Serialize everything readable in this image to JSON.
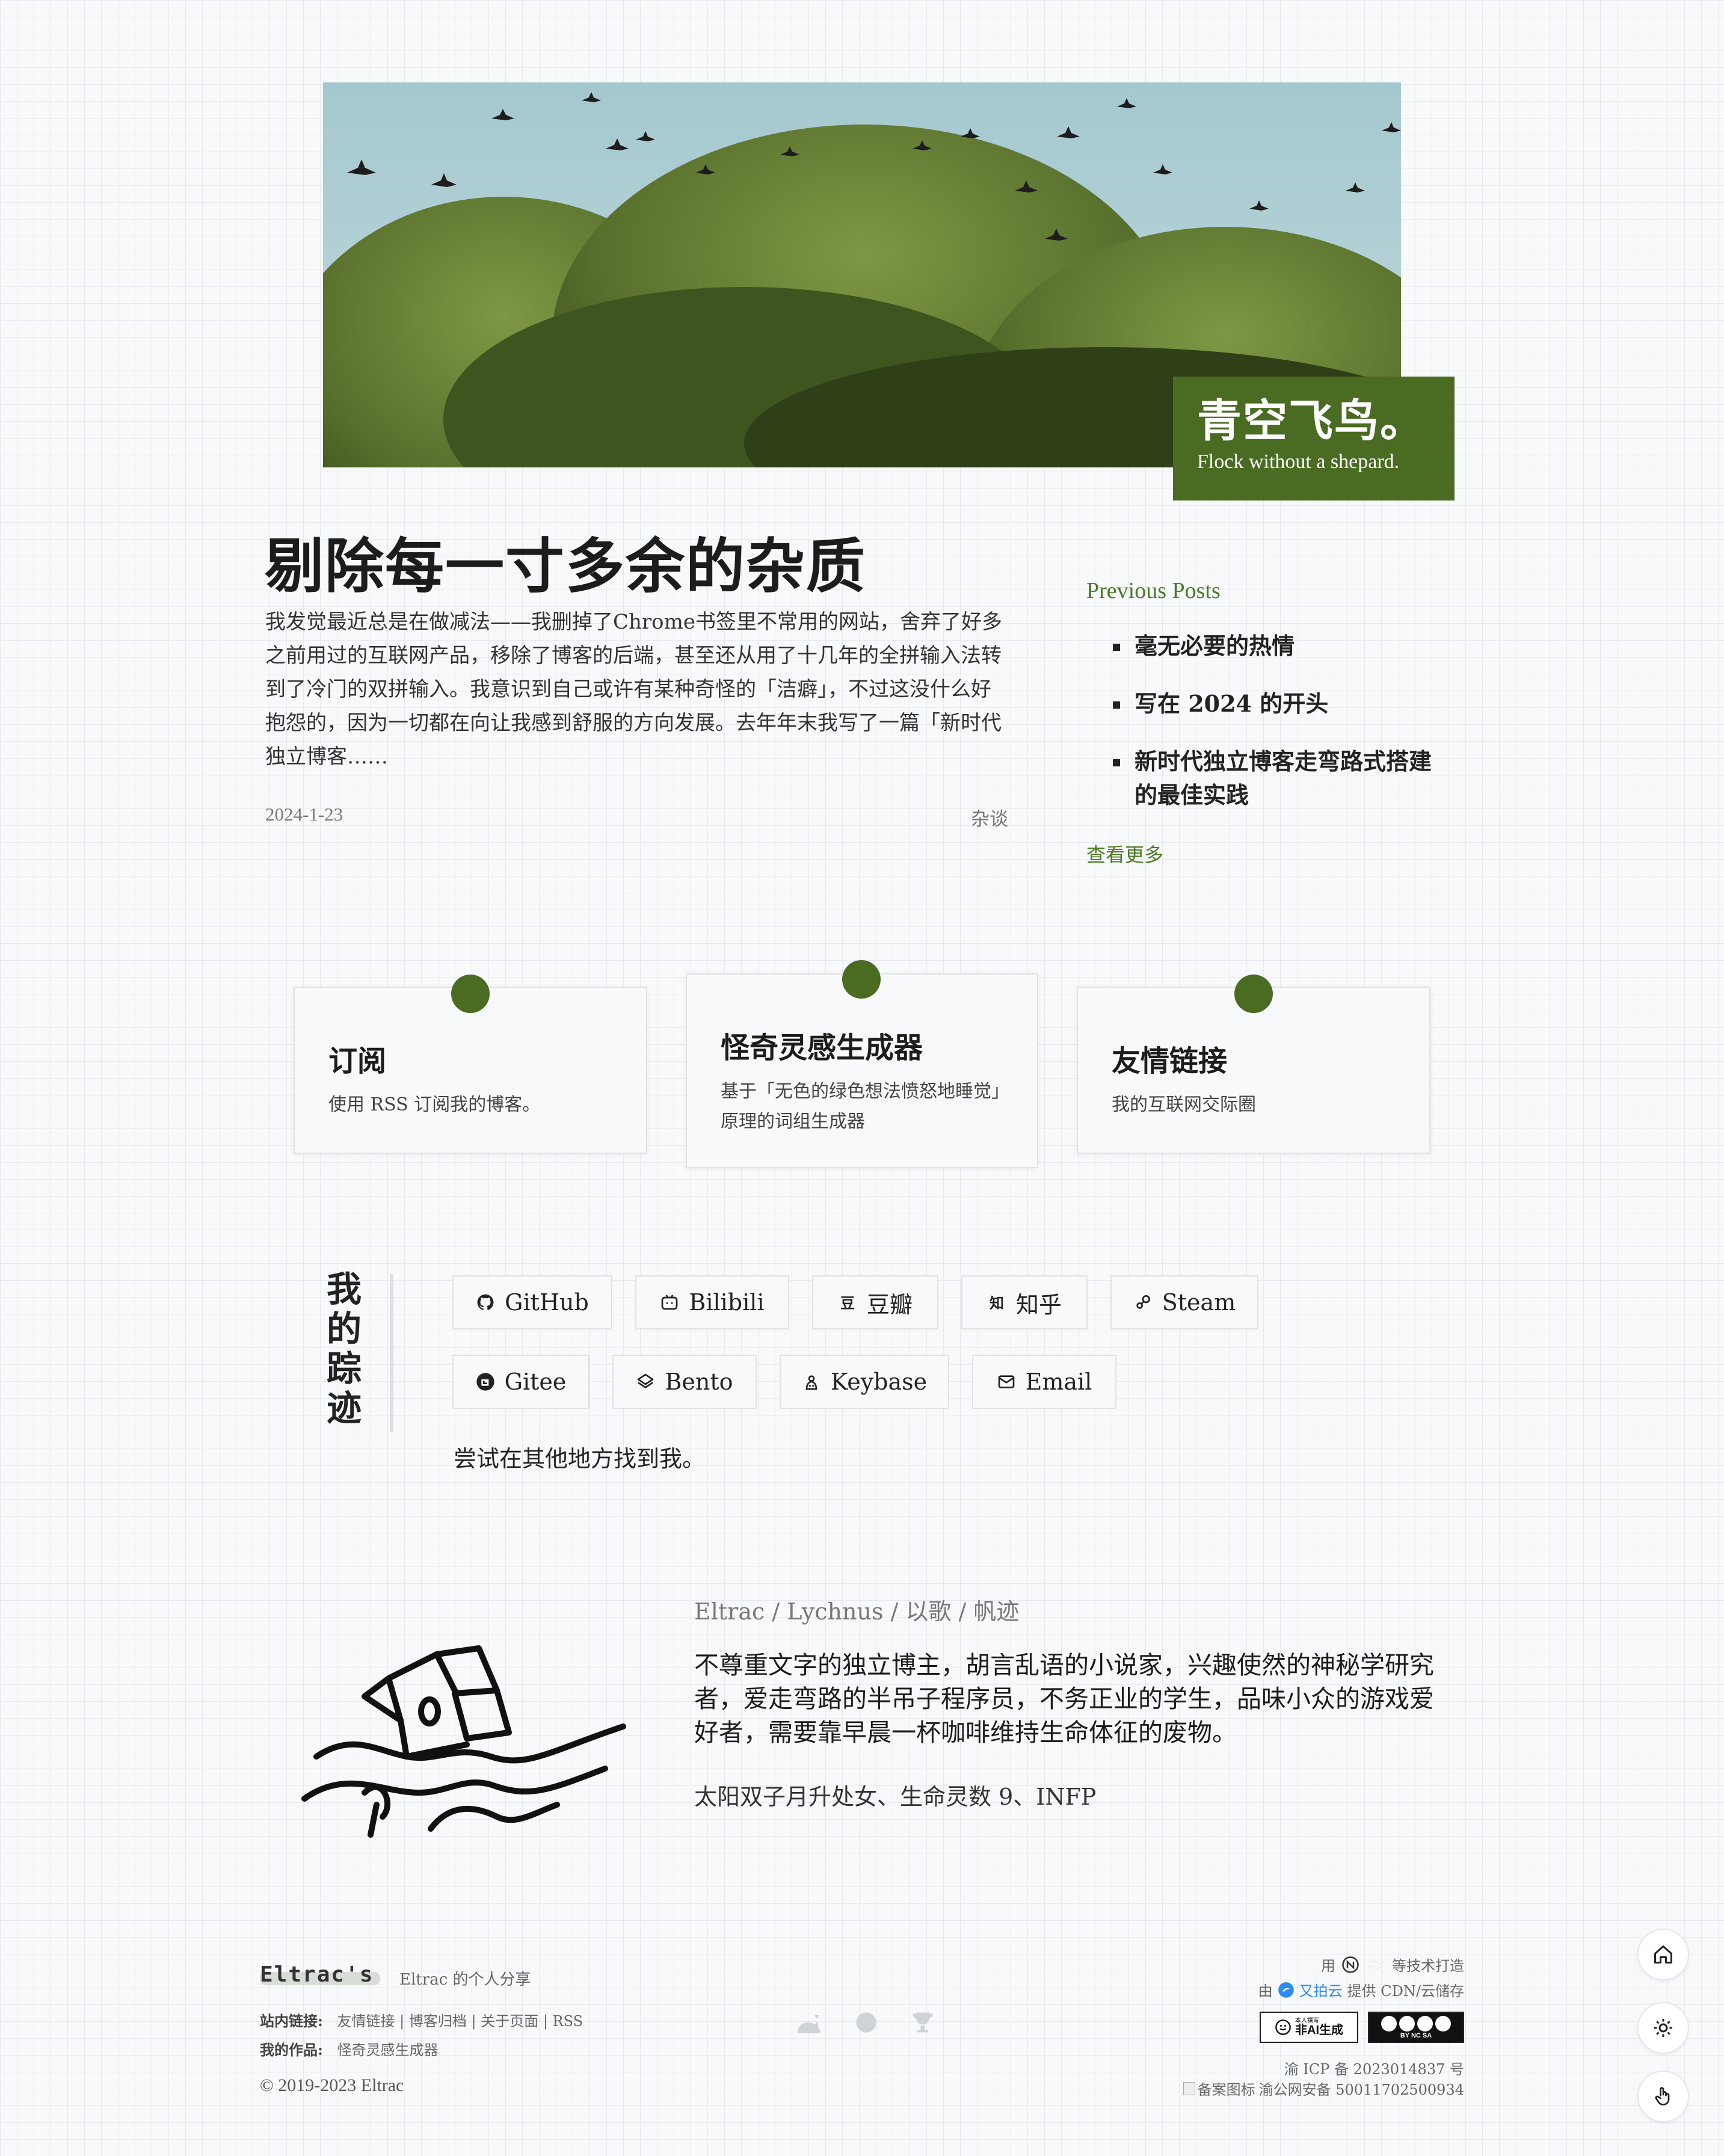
{
  "hero": {
    "title": "青空飞鸟。",
    "subtitle": "Flock without a shepard."
  },
  "post": {
    "title": "剔除每一寸多余的杂质",
    "excerpt": "我发觉最近总是在做减法——我删掉了Chrome书签里不常用的网站，舍弃了好多之前用过的互联网产品，移除了博客的后端，甚至还从用了十几年的全拼输入法转到了冷门的双拼输入。我意识到自己或许有某种奇怪的「洁癖」，不过这没什么好抱怨的，因为一切都在向让我感到舒服的方向发展。去年年末我写了一篇「新时代独立博客……",
    "date": "2024-1-23",
    "category": "杂谈"
  },
  "previous": {
    "heading": "Previous Posts",
    "items": [
      "毫无必要的热情",
      "写在 2024 的开头",
      "新时代独立博客走弯路式搭建的最佳实践"
    ],
    "more": "查看更多"
  },
  "cards": [
    {
      "title": "订阅",
      "desc": "使用 RSS 订阅我的博客。"
    },
    {
      "title": "怪奇灵感生成器",
      "desc": "基于「无色的绿色想法愤怒地睡觉」原理的词组生成器"
    },
    {
      "title": "友情链接",
      "desc": "我的互联网交际圈"
    }
  ],
  "traces": {
    "title": "我的踪迹",
    "links": [
      {
        "label": "GitHub",
        "icon": "github-icon"
      },
      {
        "label": "Bilibili",
        "icon": "bilibili-icon"
      },
      {
        "label": "豆瓣",
        "icon": "douban-icon"
      },
      {
        "label": "知乎",
        "icon": "zhihu-icon"
      },
      {
        "label": "Steam",
        "icon": "steam-icon"
      },
      {
        "label": "Gitee",
        "icon": "gitee-icon"
      },
      {
        "label": "Bento",
        "icon": "bento-icon"
      },
      {
        "label": "Keybase",
        "icon": "keybase-icon"
      },
      {
        "label": "Email",
        "icon": "mail-icon"
      }
    ],
    "note": "尝试在其他地方找到我。"
  },
  "about": {
    "names": "Eltrac / Lychnus / 以歌 / 帆迹",
    "description": "不尊重文字的独立博主，胡言乱语的小说家，兴趣使然的神秘学研究者，爱走弯路的半吊子程序员，不务正业的学生，品味小众的游戏爱好者，需要靠早晨一杯咖啡维持生命体征的废物。",
    "tags": "太阳双子月升处女、生命灵数 9、INFP"
  },
  "footer": {
    "logo": "Eltrac's",
    "tagline": "Eltrac 的个人分享",
    "site_links_label": "站内链接:",
    "site_links": "友情链接 | 博客归档 | 关于页面 | RSS",
    "works_label": "我的作品:",
    "works": "怪奇灵感生成器",
    "copyright": "© 2019-2023 Eltrac",
    "built_prefix": "用",
    "built_suffix": "等技术打造",
    "cdn_prefix": "由",
    "cdn_brand": "又拍云",
    "cdn_suffix": "提供 CDN/云储存",
    "badge_ai_top": "本人撰写",
    "badge_ai": "非AI生成",
    "badge_cc": "BY NC SA",
    "icp": "渝 ICP 备 2023014837 号",
    "police_alt": "备案图标",
    "police": "渝公网安备 50011702500934"
  },
  "colors": {
    "accent": "#4a6b22",
    "link": "#4a7a22",
    "background": "#f8f9fb"
  }
}
